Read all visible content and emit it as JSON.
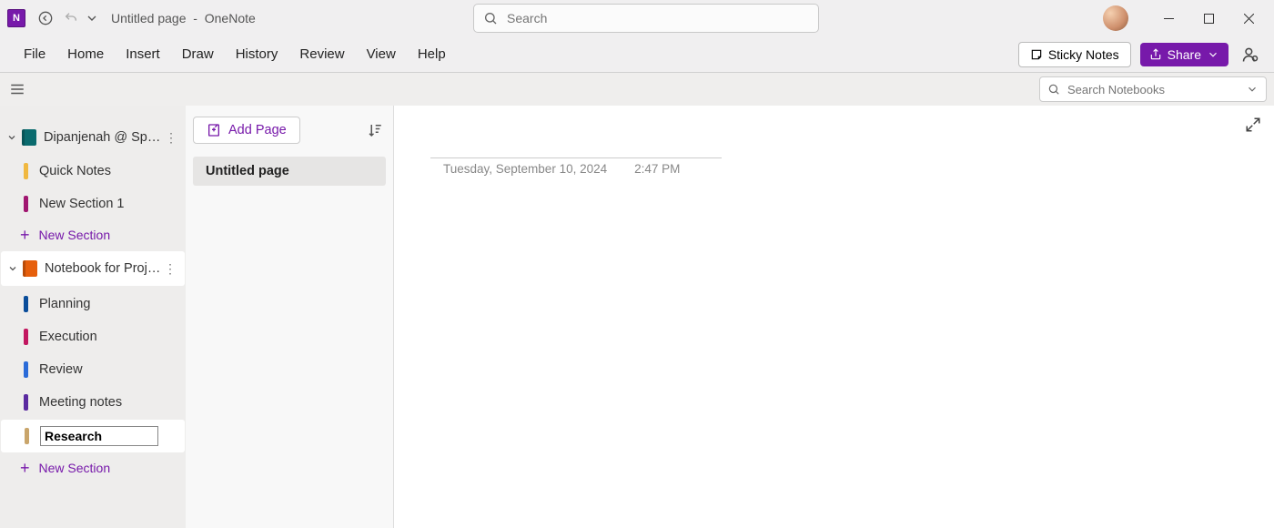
{
  "titlebar": {
    "page_title": "Untitled page",
    "app_name": "OneNote",
    "separator": "-",
    "search_placeholder": "Search"
  },
  "menubar": {
    "items": [
      "File",
      "Home",
      "Insert",
      "Draw",
      "History",
      "Review",
      "View",
      "Help"
    ],
    "sticky_notes": "Sticky Notes",
    "share": "Share"
  },
  "secbar": {
    "search_notebooks_placeholder": "Search Notebooks"
  },
  "sidebar": {
    "notebooks": [
      {
        "name": "Dipanjenah @ Spiral...",
        "color": "teal",
        "selected": false,
        "sections": [
          {
            "name": "Quick Notes",
            "color": "#f0b840"
          },
          {
            "name": "New Section 1",
            "color": "#a01670"
          }
        ]
      },
      {
        "name": "Notebook for Project A",
        "color": "orange",
        "selected": true,
        "sections": [
          {
            "name": "Planning",
            "color": "#0a4d9a"
          },
          {
            "name": "Execution",
            "color": "#c21760"
          },
          {
            "name": "Review",
            "color": "#2a6bd8"
          },
          {
            "name": "Meeting notes",
            "color": "#5a2aa0"
          },
          {
            "name": "Research",
            "color": "#c9a56b",
            "editing": true
          }
        ]
      }
    ],
    "new_section_label": "New Section"
  },
  "pagelist": {
    "add_page_label": "Add Page",
    "pages": [
      {
        "title": "Untitled page",
        "selected": true
      }
    ]
  },
  "canvas": {
    "date": "Tuesday, September 10, 2024",
    "time": "2:47 PM"
  }
}
